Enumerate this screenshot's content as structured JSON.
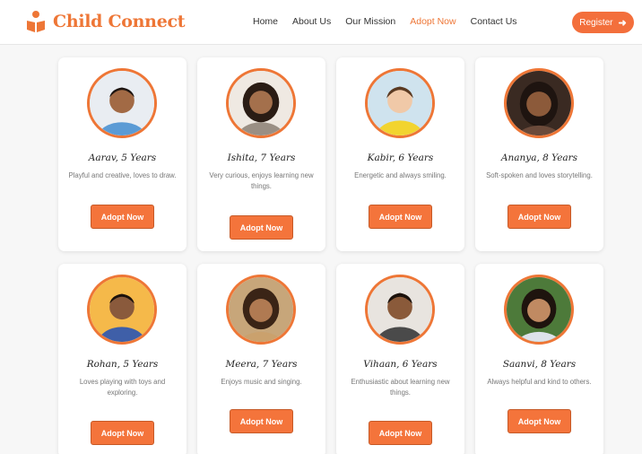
{
  "brand": {
    "name": "Child Connect",
    "icon": "reading-child-icon",
    "accent": "#ee7636"
  },
  "nav": {
    "links": [
      "Home",
      "About Us",
      "Our Mission",
      "Adopt Now",
      "Contact Us"
    ],
    "active": "Adopt Now"
  },
  "register": {
    "label": "Register",
    "icon": "arrow-right-icon"
  },
  "children": [
    {
      "name": "Aarav, 5 Years",
      "description": "Playful and creative, loves to draw.",
      "button": "Adopt Now"
    },
    {
      "name": "Ishita, 7 Years",
      "description": "Very curious, enjoys learning new things.",
      "button": "Adopt Now"
    },
    {
      "name": "Kabir, 6 Years",
      "description": "Energetic and always smiling.",
      "button": "Adopt Now"
    },
    {
      "name": "Ananya, 8 Years",
      "description": "Soft-spoken and loves storytelling.",
      "button": "Adopt Now"
    },
    {
      "name": "Rohan, 5 Years",
      "description": "Loves playing with toys and exploring.",
      "button": "Adopt Now"
    },
    {
      "name": "Meera, 7 Years",
      "description": "Enjoys music and singing.",
      "button": "Adopt Now"
    },
    {
      "name": "Vihaan, 6 Years",
      "description": "Enthusiastic about learning new things.",
      "button": "Adopt Now"
    },
    {
      "name": "Saanvi, 8 Years",
      "description": "Always helpful and kind to others.",
      "button": "Adopt Now"
    }
  ],
  "colors": {
    "accent": "#ee7636",
    "button": "#f4743b",
    "register": "#f36f3c"
  }
}
